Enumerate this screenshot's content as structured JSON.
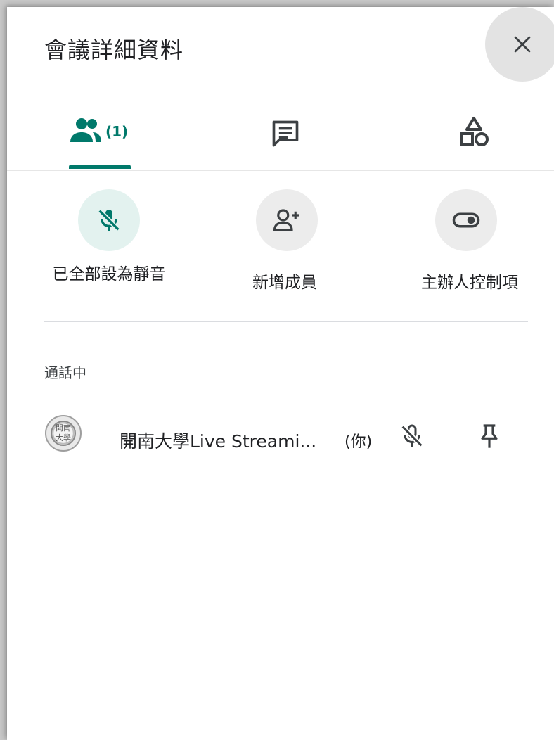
{
  "panel": {
    "title": "會議詳細資料",
    "close_icon": "close-icon"
  },
  "tabs": [
    {
      "name": "people",
      "icon": "people-icon",
      "count_label": "(1)",
      "selected": true
    },
    {
      "name": "chat",
      "icon": "chat-icon",
      "selected": false
    },
    {
      "name": "activities",
      "icon": "shapes-icon",
      "selected": false
    }
  ],
  "actions": {
    "mute_all": {
      "label": "已全部設為靜音",
      "icon": "mic-off-icon",
      "active": true
    },
    "add_people": {
      "label": "新增成員",
      "icon": "person-add-icon"
    },
    "host_controls": {
      "label": "主辦人控制項",
      "icon": "toggle-icon"
    }
  },
  "section": {
    "in_call_title": "通話中"
  },
  "participants": [
    {
      "avatar_icon": "university-seal-avatar",
      "avatar_text": "開南大學",
      "name": "開南大學Live Streami...",
      "you_label": "(你)",
      "mic_icon": "mic-off-icon",
      "pin_icon": "pin-icon"
    }
  ],
  "colors": {
    "accent": "#00796b",
    "active_circle": "#e3f2ef",
    "circle": "#ececec"
  }
}
